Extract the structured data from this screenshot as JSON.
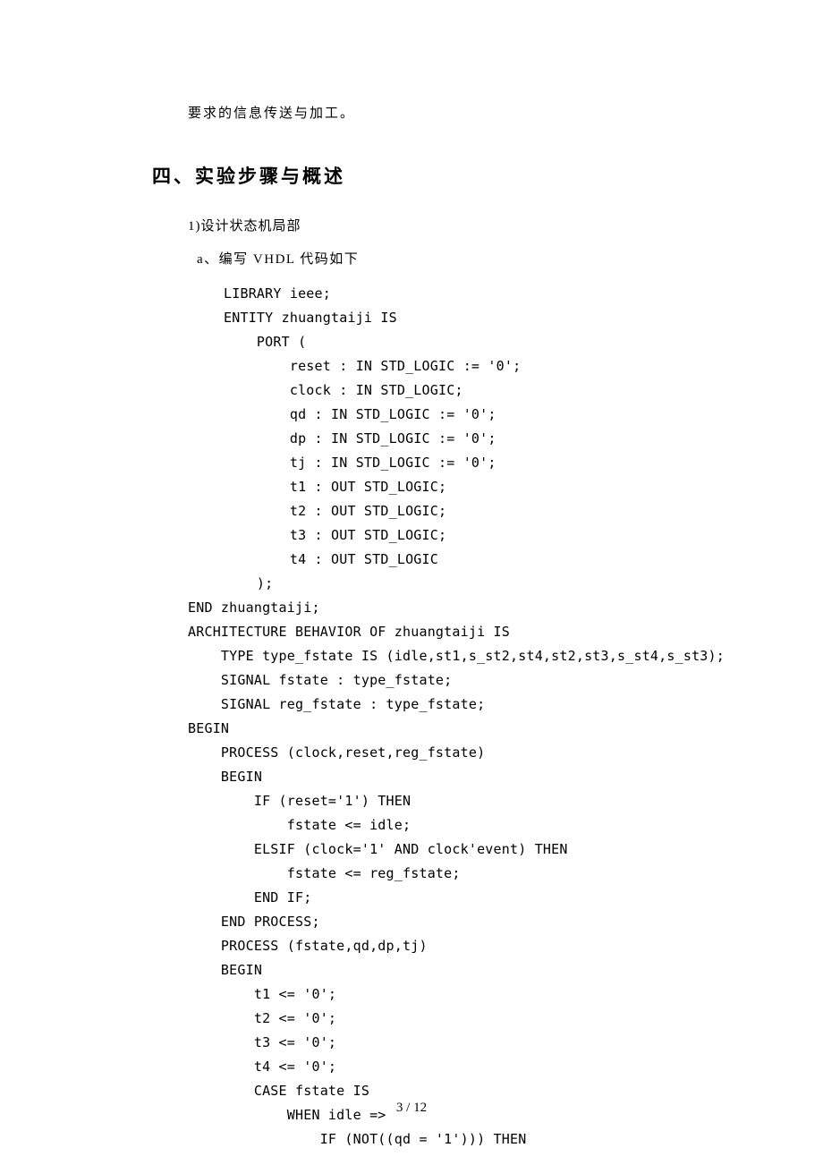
{
  "intro": "要求的信息传送与加工。",
  "sectionHeading": "四、实验步骤与概述",
  "step1": "1)设计状态机局部",
  "step1a": "a、编写 VHDL 代码如下",
  "code": {
    "l0": "LIBRARY ieee;",
    "l1": "",
    "l2": "ENTITY zhuangtaiji IS",
    "l3": "    PORT (",
    "l4": "        reset : IN STD_LOGIC := '0';",
    "l5": "        clock : IN STD_LOGIC;",
    "l6": "        qd : IN STD_LOGIC := '0';",
    "l7": "        dp : IN STD_LOGIC := '0';",
    "l8": "        tj : IN STD_LOGIC := '0';",
    "l9": "        t1 : OUT STD_LOGIC;",
    "l10": "        t2 : OUT STD_LOGIC;",
    "l11": "        t3 : OUT STD_LOGIC;",
    "l12": "        t4 : OUT STD_LOGIC",
    "l13": "    );",
    "l14": "END zhuangtaiji;",
    "l15": "ARCHITECTURE BEHAVIOR OF zhuangtaiji IS",
    "l16": "    TYPE type_fstate IS (idle,st1,s_st2,st4,st2,st3,s_st4,s_st3);",
    "l17": "    SIGNAL fstate : type_fstate;",
    "l18": "    SIGNAL reg_fstate : type_fstate;",
    "l19": "BEGIN",
    "l20": "    PROCESS (clock,reset,reg_fstate)",
    "l21": "    BEGIN",
    "l22": "        IF (reset='1') THEN",
    "l23": "            fstate <= idle;",
    "l24": "        ELSIF (clock='1' AND clock'event) THEN",
    "l25": "            fstate <= reg_fstate;",
    "l26": "        END IF;",
    "l27": "    END PROCESS;",
    "l28": "    PROCESS (fstate,qd,dp,tj)",
    "l29": "    BEGIN",
    "l30": "        t1 <= '0';",
    "l31": "        t2 <= '0';",
    "l32": "        t3 <= '0';",
    "l33": "        t4 <= '0';",
    "l34": "        CASE fstate IS",
    "l35": "            WHEN idle =>",
    "l36": "                IF (NOT((qd = '1'))) THEN"
  },
  "pageNumber": "3 / 12"
}
